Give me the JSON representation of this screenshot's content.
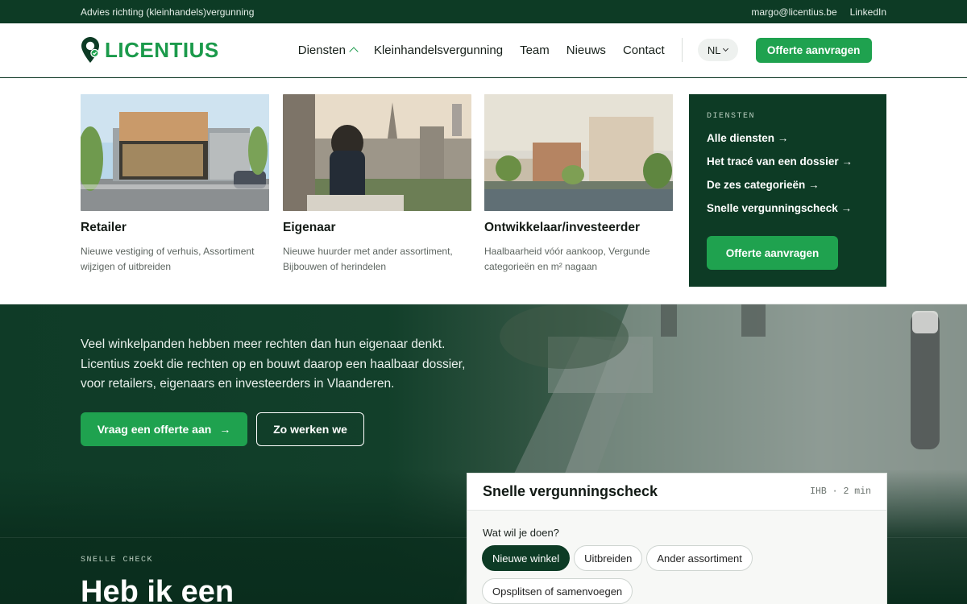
{
  "topbar": {
    "tagline": "Advies richting (kleinhandels)vergunning",
    "email": "margo@licentius.be",
    "linkedin": "LinkedIn"
  },
  "header": {
    "logo_text": "LICENTIUS",
    "nav": [
      {
        "label": "Diensten"
      },
      {
        "label": "Kleinhandelsvergunning"
      },
      {
        "label": "Team"
      },
      {
        "label": "Nieuws"
      },
      {
        "label": "Contact"
      }
    ],
    "lang": "NL",
    "cta": "Offerte aanvragen"
  },
  "mega": {
    "cards": [
      {
        "title": "Retailer",
        "desc": "Nieuwe vestiging of verhuis, Assortiment wijzigen of uitbreiden"
      },
      {
        "title": "Eigenaar",
        "desc": "Nieuwe huurder met ander assortiment, Bijbouwen of herindelen"
      },
      {
        "title": "Ontwikkelaar/investeerder",
        "desc": "Haalbaarheid vóór aankoop, Vergunde categorieën en m² nagaan"
      }
    ],
    "side": {
      "label": "DIENSTEN",
      "links": [
        "Alle diensten →",
        "Het tracé van een dossier →",
        "De zes categorieën →",
        "Snelle vergunningscheck →"
      ],
      "button": "Offerte aanvragen"
    }
  },
  "hero": {
    "lead": "Veel winkelpanden hebben meer rechten dan hun eigenaar denkt. Licentius zoekt die rechten op en bouwt daarop een haalbaar dossier, voor retailers, eigenaars en investeerders in Vlaanderen.",
    "primary": "Vraag een offerte aan",
    "primary_arrow": "→",
    "secondary": "Zo werken we"
  },
  "snelle": {
    "label": "SNELLE CHECK",
    "heading": "Heb ik een"
  },
  "check": {
    "title": "Snelle vergunningscheck",
    "meta": "IHB · 2 min",
    "question": "Wat wil je doen?",
    "options": [
      "Nieuwe winkel",
      "Uitbreiden",
      "Ander assortiment",
      "Opsplitsen of samenvoegen"
    ]
  },
  "colors": {
    "brand_green": "#1fa24f",
    "dark_green": "#0d3b25"
  }
}
